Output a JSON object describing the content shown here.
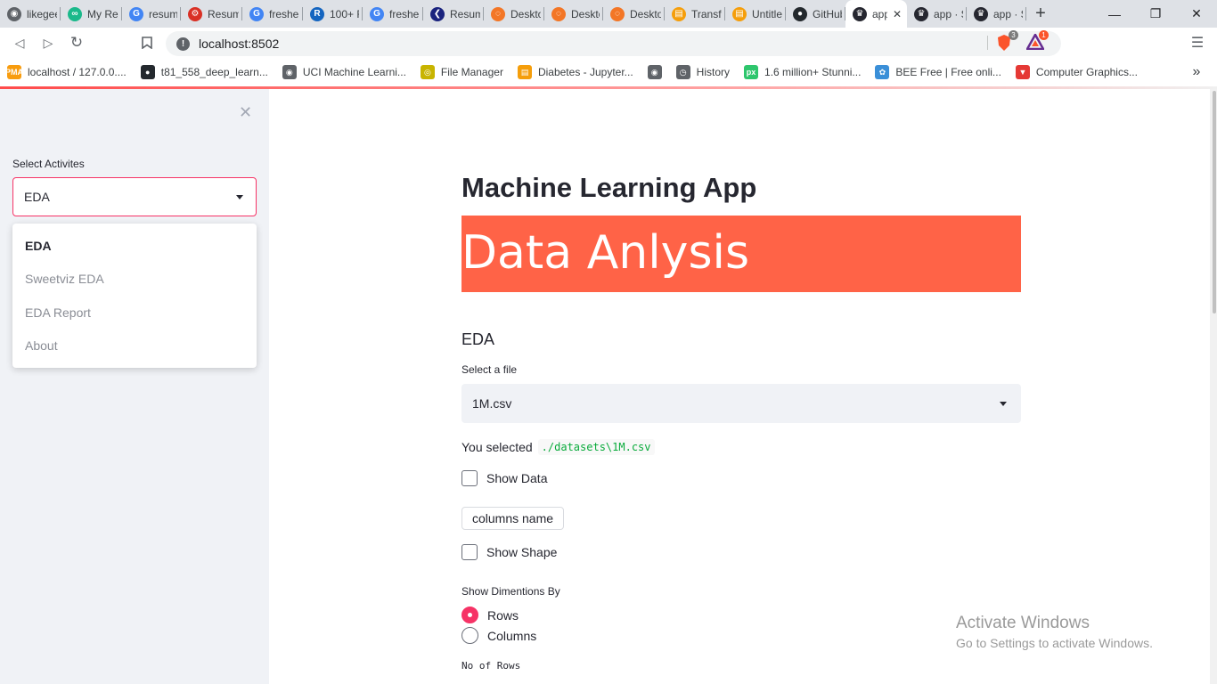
{
  "browser": {
    "tabs": [
      {
        "title": "likegee",
        "icon": "globe-icon",
        "color": "#5f6368",
        "glyph": "◉"
      },
      {
        "title": "My Res",
        "icon": "infinity-icon",
        "color": "#1bb98b",
        "glyph": "∞"
      },
      {
        "title": "resum",
        "icon": "google-icon",
        "color": "#4285f4",
        "glyph": "G"
      },
      {
        "title": "Resum",
        "icon": "rebel-icon",
        "color": "#d93025",
        "glyph": "⚙"
      },
      {
        "title": "freshe",
        "icon": "google-icon",
        "color": "#4285f4",
        "glyph": "G"
      },
      {
        "title": "100+ F",
        "icon": "r-icon",
        "color": "#1565c0",
        "glyph": "R"
      },
      {
        "title": "freshe",
        "icon": "google-icon",
        "color": "#4285f4",
        "glyph": "G"
      },
      {
        "title": "Resum",
        "icon": "k-icon",
        "color": "#1a237e",
        "glyph": "❮"
      },
      {
        "title": "Deskto",
        "icon": "jupyter-icon",
        "color": "#f37626",
        "glyph": "◌"
      },
      {
        "title": "Deskto",
        "icon": "jupyter-icon",
        "color": "#f37626",
        "glyph": "◌"
      },
      {
        "title": "Deskto",
        "icon": "jupyter-icon",
        "color": "#f37626",
        "glyph": "◌"
      },
      {
        "title": "Transfe",
        "icon": "notebook-icon",
        "color": "#f59e0b",
        "glyph": "▤"
      },
      {
        "title": "Untitle",
        "icon": "notebook-icon",
        "color": "#f59e0b",
        "glyph": "▤"
      },
      {
        "title": "GitHub",
        "icon": "github-icon",
        "color": "#24292e",
        "glyph": "●"
      },
      {
        "title": "app",
        "icon": "streamlit-icon",
        "color": "#262730",
        "glyph": "♛",
        "active": true
      },
      {
        "title": "app · S",
        "icon": "streamlit-icon",
        "color": "#262730",
        "glyph": "♛"
      },
      {
        "title": "app · S",
        "icon": "streamlit-icon",
        "color": "#262730",
        "glyph": "♛"
      }
    ],
    "new_tab": "+",
    "window_controls": {
      "minimize": "—",
      "restore": "❐",
      "close": "✕"
    },
    "tab_close": "✕",
    "url": "localhost:8502",
    "extensions": [
      {
        "name": "brave-shields-icon",
        "badge": "3",
        "color": "#fb542b"
      },
      {
        "name": "brave-rewards-icon",
        "badge": "1",
        "color": "#fb542b"
      }
    ],
    "bookmarks": [
      {
        "title": "localhost / 127.0.0....",
        "icon": "phpmyadmin-icon",
        "color": "#f89c0e",
        "glyph": "PMA"
      },
      {
        "title": "t81_558_deep_learn...",
        "icon": "github-icon",
        "color": "#24292e",
        "glyph": "●"
      },
      {
        "title": "UCI Machine Learni...",
        "icon": "globe-icon",
        "color": "#5f6368",
        "glyph": "◉"
      },
      {
        "title": "File Manager",
        "icon": "file-manager-icon",
        "color": "#c8b400",
        "glyph": "◎"
      },
      {
        "title": "Diabetes - Jupyter...",
        "icon": "notebook-icon",
        "color": "#f59e0b",
        "glyph": "▤"
      },
      {
        "title": "",
        "icon": "globe-icon",
        "color": "#5f6368",
        "glyph": "◉"
      },
      {
        "title": "History",
        "icon": "history-icon",
        "color": "#5f6368",
        "glyph": "◷"
      },
      {
        "title": "1.6 million+ Stunni...",
        "icon": "pixabay-icon",
        "color": "#2ec66d",
        "glyph": "px"
      },
      {
        "title": "BEE Free | Free onli...",
        "icon": "bee-icon",
        "color": "#3a8fd8",
        "glyph": "✿"
      },
      {
        "title": "Computer Graphics...",
        "icon": "v-icon",
        "color": "#e53935",
        "glyph": "▼"
      }
    ],
    "bookmarks_more": "»"
  },
  "sidebar": {
    "close": "✕",
    "label": "Select Activites",
    "selected": "EDA",
    "options": [
      "EDA",
      "Sweetviz EDA",
      "EDA Report",
      "About"
    ]
  },
  "main": {
    "title": "Machine Learning App",
    "banner": "Data Anlysis",
    "section": "EDA",
    "file_label": "Select a file",
    "file_value": "1M.csv",
    "you_selected": "You selected",
    "selected_path": "./datasets\\1M.csv",
    "show_data": "Show Data",
    "columns_button": "columns name",
    "show_shape": "Show Shape",
    "dimensions_label": "Show Dimentions By",
    "radio_options": [
      "Rows",
      "Columns"
    ],
    "radio_selected": "Rows",
    "no_rows": "No of Rows"
  },
  "watermark": {
    "line1": "Activate Windows",
    "line2": "Go to Settings to activate Windows."
  },
  "colors": {
    "accent": "#f63366",
    "banner_bg": "#ff6347",
    "sidebar_bg": "#f0f2f6"
  }
}
